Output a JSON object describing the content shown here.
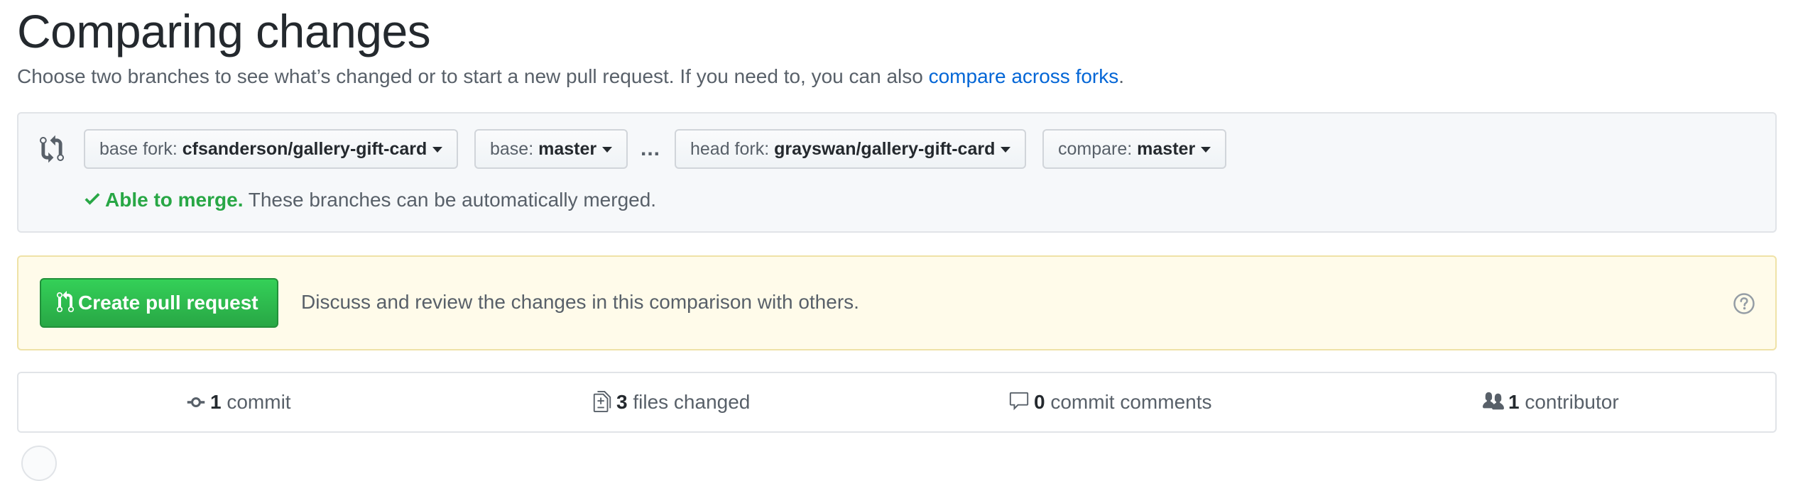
{
  "page": {
    "title": "Comparing changes",
    "subtitle_text": "Choose two branches to see what’s changed or to start a new pull request. If you need to, you can also ",
    "subtitle_link": "compare across forks",
    "subtitle_end": "."
  },
  "range": {
    "base_fork_label": "base fork:",
    "base_fork_value": "cfsanderson/gallery-gift-card",
    "base_label": "base:",
    "base_value": "master",
    "ellipsis": "...",
    "head_fork_label": "head fork:",
    "head_fork_value": "grayswan/gallery-gift-card",
    "compare_label": "compare:",
    "compare_value": "master",
    "merge_ok": "Able to merge.",
    "merge_text": " These branches can be automatically merged."
  },
  "pull_request": {
    "button_label": "Create pull request",
    "description": "Discuss and review the changes in this comparison with others."
  },
  "summary": {
    "commits_count": "1",
    "commits_label": " commit",
    "files_count": "3",
    "files_label": " files changed",
    "comments_count": "0",
    "comments_label": " commit comments",
    "contributors_count": "1",
    "contributors_label": " contributor"
  },
  "colors": {
    "link": "#0366d6",
    "success": "#28a745",
    "button_green": "#2ea44f",
    "notice_bg": "#fffbea"
  },
  "icons": [
    "git-compare-icon",
    "check-icon",
    "git-pull-request-icon",
    "question-icon",
    "git-commit-icon",
    "file-diff-icon",
    "comment-icon",
    "people-icon"
  ]
}
